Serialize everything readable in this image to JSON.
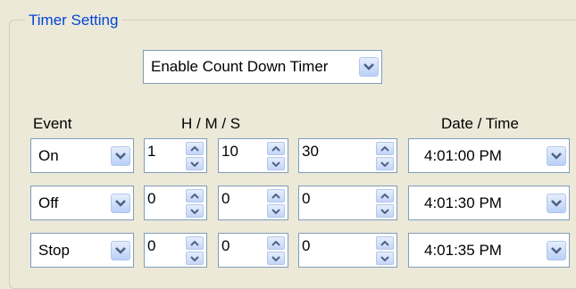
{
  "group_title": "Timer Setting",
  "mode_select": {
    "value": "Enable Count Down Timer"
  },
  "headers": {
    "event": "Event",
    "hms": "H / M / S",
    "datetime": "Date / Time"
  },
  "rows": [
    {
      "event": "On",
      "h": "1",
      "m": "10",
      "s": "30",
      "time": "4:01:00 PM"
    },
    {
      "event": "Off",
      "h": "0",
      "m": "0",
      "s": "0",
      "time": "4:01:30 PM"
    },
    {
      "event": "Stop",
      "h": "0",
      "m": "0",
      "s": "0",
      "time": "4:01:35 PM"
    }
  ],
  "icons": {
    "dropdown": "chevron-down-icon",
    "spin_up": "arrow-up-icon",
    "spin_down": "arrow-down-icon"
  },
  "colors": {
    "title": "#0046d5",
    "button_arrow": "#4d6185",
    "border": "#7f9db9"
  }
}
